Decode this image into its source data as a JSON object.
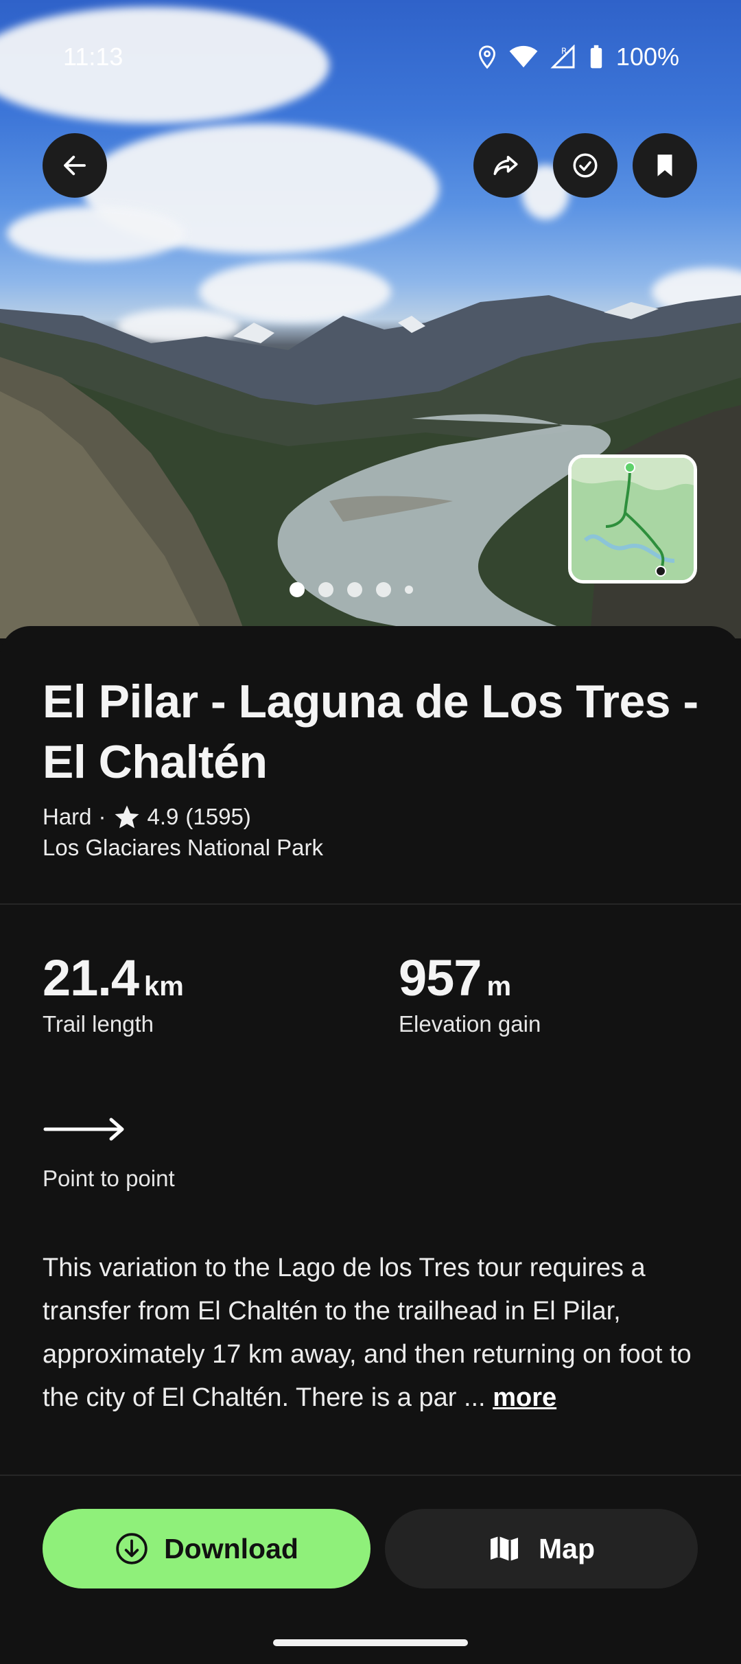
{
  "status_bar": {
    "time": "11:13",
    "battery": "100%"
  },
  "hero": {
    "photo_index": 1,
    "photo_count": 5
  },
  "trail": {
    "title": "El Pilar - Laguna de Los Tres - El Chaltén",
    "difficulty": "Hard",
    "separator": "·",
    "rating": "4.9",
    "review_count": "(1595)",
    "park": "Los Glaciares National Park"
  },
  "stats": {
    "length": {
      "value": "21.4",
      "unit": "km",
      "label": "Trail length"
    },
    "elevation": {
      "value": "957",
      "unit": "m",
      "label": "Elevation gain"
    }
  },
  "route": {
    "type": "Point to point"
  },
  "description": {
    "text": "This variation to the Lago de los Tres tour requires a transfer from El Chaltén to the trailhead in El Pilar, approximately 17 km away, and then returning on foot to the city of El Chaltén. There is a par ...",
    "more_label": "more"
  },
  "actions": {
    "download_label": "Download",
    "map_label": "Map"
  },
  "colors": {
    "download_bg": "#8ff07a",
    "sheet_bg": "#121212",
    "map_btn_bg": "#232323"
  },
  "icons": [
    "back-arrow-icon",
    "share-icon",
    "check-circle-icon",
    "bookmark-icon",
    "star-icon",
    "download-icon",
    "map-icon",
    "location-icon",
    "wifi-icon",
    "signal-icon",
    "battery-icon"
  ]
}
